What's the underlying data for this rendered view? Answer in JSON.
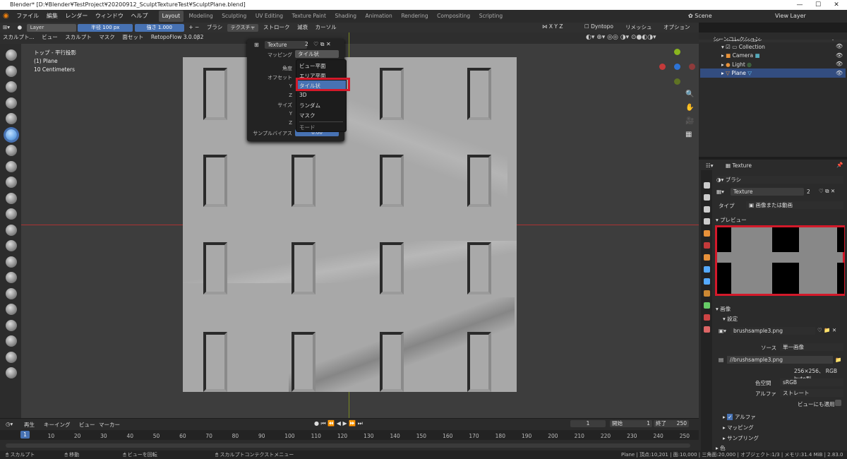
{
  "title": "Blender* [D:¥Blender¥TestProject¥20200912_SculptTextureTest¥SculptPlane.blend]",
  "menu": {
    "file": "ファイル",
    "edit": "編集",
    "render": "レンダー",
    "window": "ウィンドウ",
    "help": "ヘルプ"
  },
  "workspaces": [
    "Layout",
    "Modeling",
    "Sculpting",
    "UV Editing",
    "Texture Paint",
    "Shading",
    "Animation",
    "Rendering",
    "Compositing",
    "Scripting"
  ],
  "scene": "Scene",
  "view_layer": "View Layer",
  "toolheader": {
    "layer": "Layer",
    "radius_label": "半径",
    "radius_value": "100 px",
    "strength_label": "強さ",
    "strength_value": "1.000",
    "brush": "ブラシ",
    "texture": "テクスチャ",
    "stroke": "ストローク",
    "falloff": "減衰",
    "cursor": "カーソル",
    "dyntopo": "Dyntopo",
    "remesh": "リメッシュ",
    "options": "オプション",
    "x": "X",
    "y": "Y",
    "z": "Z"
  },
  "header2": {
    "mode": "スカルプト...",
    "view": "ビュー",
    "sculpt": "スカルプト",
    "mask": "マスク",
    "face_set": "面セット",
    "retopo": "RetopoFlow 3.0.0β2"
  },
  "viewport_info": {
    "line1": "トップ - 平行投影",
    "line2": "(1) Plane",
    "line3": "10 Centimeters"
  },
  "popup": {
    "texture_name": "Texture",
    "texture_users": "2",
    "mapping_label": "マッピング",
    "mapping_value": "タイル状",
    "angle_label": "角度",
    "offset_label": "オフセット",
    "x": "X",
    "y": "Y",
    "z": "Z",
    "size_label": "サイズ",
    "sample_bias": "サンプルバイアス",
    "sample_value": "0.00"
  },
  "mapping_menu": [
    "ビュー平面",
    "エリア平面",
    "タイル状",
    "3D",
    "ランダム",
    "マスク"
  ],
  "mapping_menu_title": "モード",
  "outliner": {
    "title": "シーンコレクション",
    "items": [
      "Collection",
      "Camera",
      "Light",
      "Plane"
    ]
  },
  "props": {
    "header": "Texture",
    "context": "ブラシ",
    "tex_name": "Texture",
    "tex_users": "2",
    "type_label": "タイプ",
    "type_value": "画像または動画",
    "preview": "プレビュー",
    "image": "画像",
    "settings": "設定",
    "image_name": "brushsample3.png",
    "source_label": "ソース",
    "source_value": "単一画像",
    "path": "//brushsample3.png",
    "info": "256×256、 RGB byte型",
    "colorspace_label": "色空間",
    "colorspace_value": "sRGB",
    "alpha_label": "アルファ",
    "alpha_value": "ストレート",
    "view_apply": "ビューにも適用",
    "alpha_panel": "アルファ",
    "mapping_panel": "マッピング",
    "sampling_panel": "サンプリング",
    "color_panel": "色"
  },
  "timeline": {
    "playback": "再生",
    "keying": "キーイング",
    "view": "ビュー",
    "marker": "マーカー",
    "current": "1",
    "start_label": "開始",
    "start": "1",
    "end_label": "終了",
    "end": "250",
    "ticks": [
      "1",
      "10",
      "20",
      "30",
      "40",
      "50",
      "60",
      "70",
      "80",
      "90",
      "100",
      "110",
      "120",
      "130",
      "140",
      "150",
      "160",
      "170",
      "180",
      "190",
      "200",
      "210",
      "220",
      "230",
      "240",
      "250"
    ]
  },
  "status": {
    "sculpt": "スカルプト",
    "move": "移動",
    "rotate": "ビューを回転",
    "context": "スカルプトコンテクストメニュー",
    "stats": "Plane | 頂点:10,201 | 面:10,000 | 三角面:20,000 | オブジェクト:1/3 | メモリ:31.4 MiB | 2.83.0"
  }
}
